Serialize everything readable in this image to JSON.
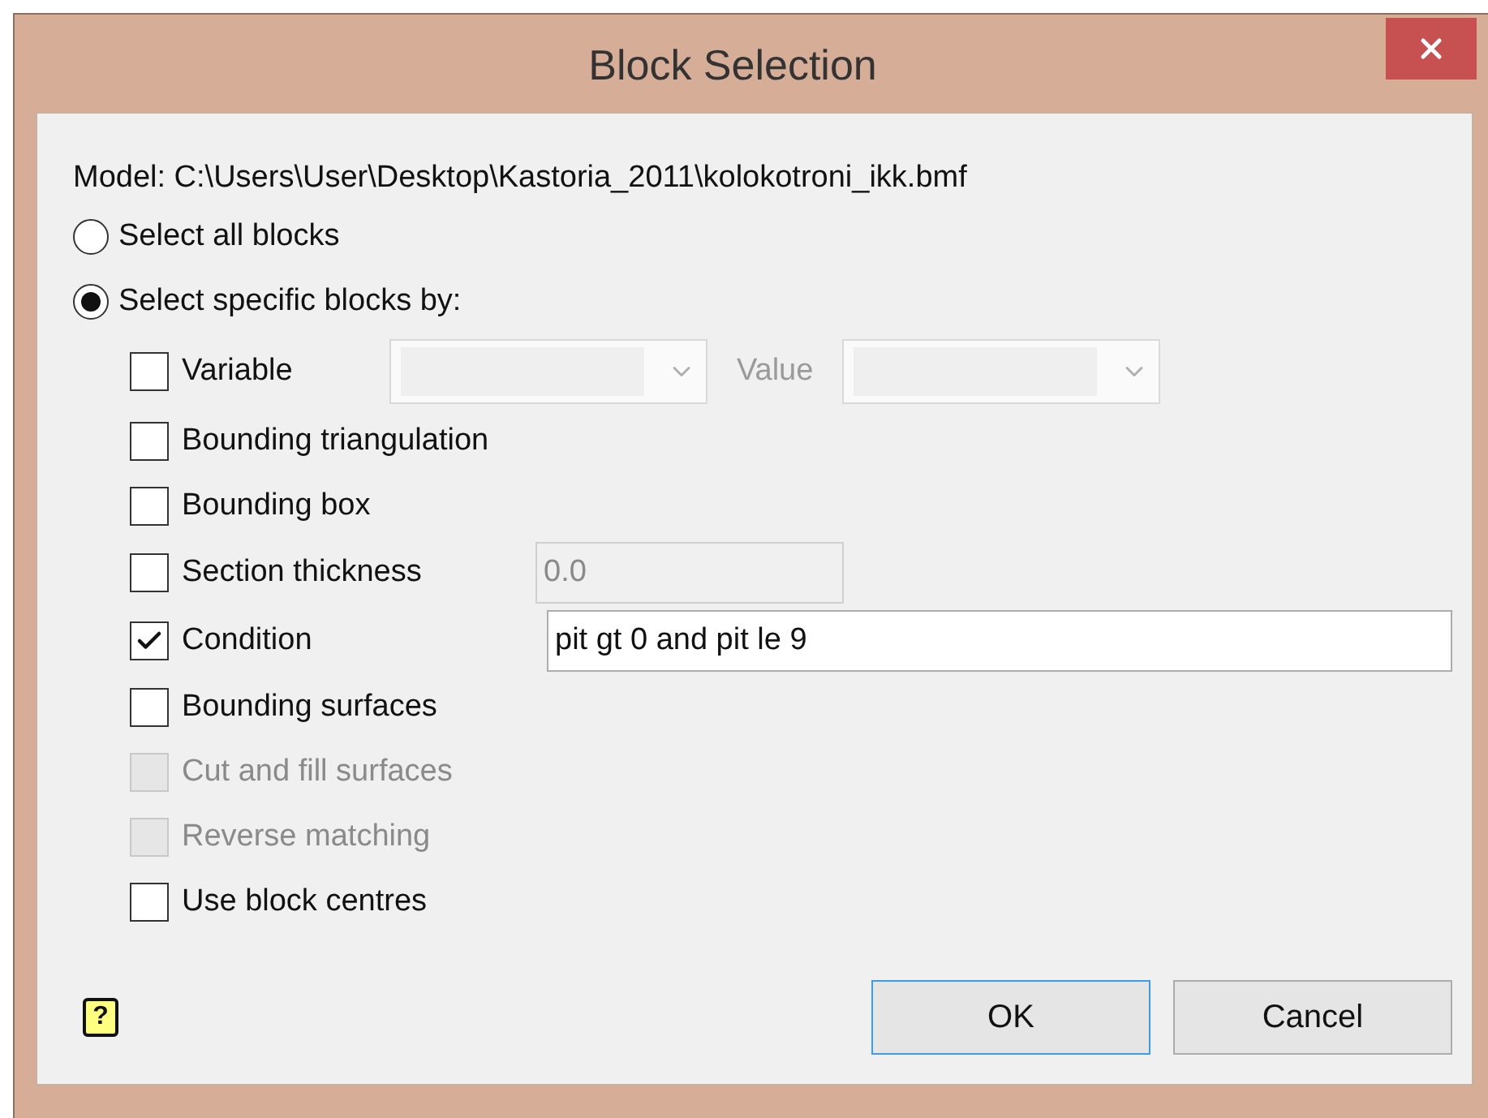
{
  "window": {
    "title": "Block Selection"
  },
  "model_label": "Model: C:\\Users\\User\\Desktop\\Kastoria_2011\\kolokotroni_ikk.bmf",
  "radios": [
    {
      "label": "Select all blocks",
      "selected": false
    },
    {
      "label": "Select specific blocks by:",
      "selected": true
    }
  ],
  "options": [
    {
      "kind": "dropdowns",
      "label": "Variable",
      "checked": false,
      "disabled": false,
      "value_label": "Value",
      "dropdowns_disabled": true
    },
    {
      "kind": "plain",
      "label": "Bounding triangulation",
      "checked": false,
      "disabled": false
    },
    {
      "kind": "plain",
      "label": "Bounding box",
      "checked": false,
      "disabled": false
    },
    {
      "kind": "field",
      "label": "Section thickness",
      "checked": false,
      "disabled": false,
      "field": {
        "value": "0.0",
        "disabled": true
      }
    },
    {
      "kind": "field",
      "label": "Condition",
      "checked": true,
      "disabled": false,
      "field": {
        "value": "pit gt 0 and pit le 9",
        "disabled": false
      }
    },
    {
      "kind": "plain",
      "label": "Bounding surfaces",
      "checked": false,
      "disabled": false
    },
    {
      "kind": "plain",
      "label": "Cut and fill surfaces",
      "checked": false,
      "disabled": true
    },
    {
      "kind": "plain",
      "label": "Reverse matching",
      "checked": false,
      "disabled": true
    },
    {
      "kind": "plain",
      "label": "Use block centres",
      "checked": false,
      "disabled": false
    }
  ],
  "help": {
    "label": "?"
  },
  "buttons": [
    {
      "label": "OK",
      "default": true
    },
    {
      "label": "Cancel",
      "default": false
    }
  ]
}
